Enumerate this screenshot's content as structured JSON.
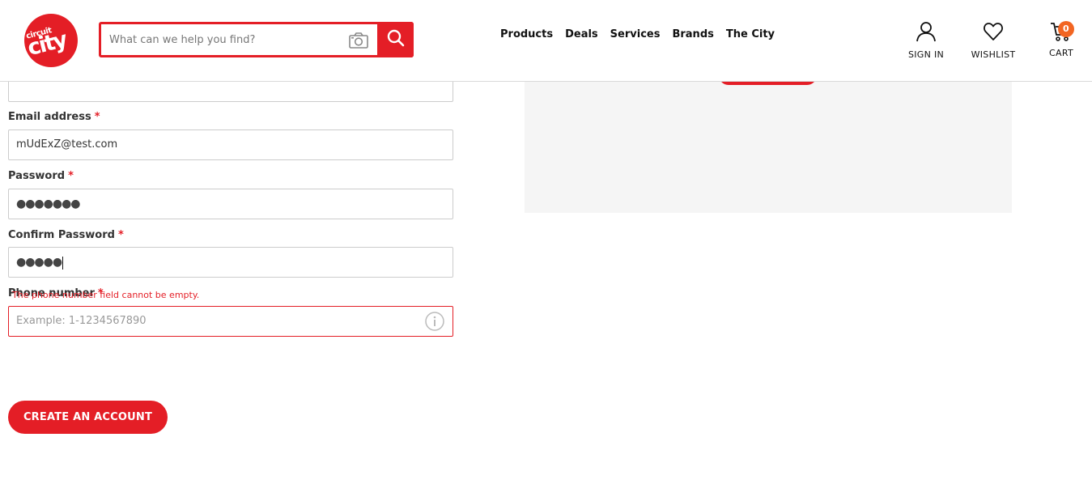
{
  "header": {
    "logo_text_small": "circuit",
    "logo_text_big": "city",
    "search_placeholder": "What can we help you find?",
    "nav": [
      "Products",
      "Deals",
      "Services",
      "Brands",
      "The City"
    ],
    "sign_in": "SIGN IN",
    "wishlist": "WISHLIST",
    "cart": "CART",
    "cart_count": "0",
    "brand_color": "#e41e26"
  },
  "form": {
    "email_label": "Email address",
    "email_value": "mUdExZ@test.com",
    "password_label": "Password",
    "password_dots": "●●●●●●●",
    "confirm_label": "Confirm Password",
    "confirm_dots": "●●●●●",
    "phone_label": "Phone number",
    "phone_placeholder": "Example: 1-1234567890",
    "phone_error": "The phone number field cannot be empty.",
    "required_mark": "*",
    "create_button": "CREATE AN ACCOUNT"
  }
}
